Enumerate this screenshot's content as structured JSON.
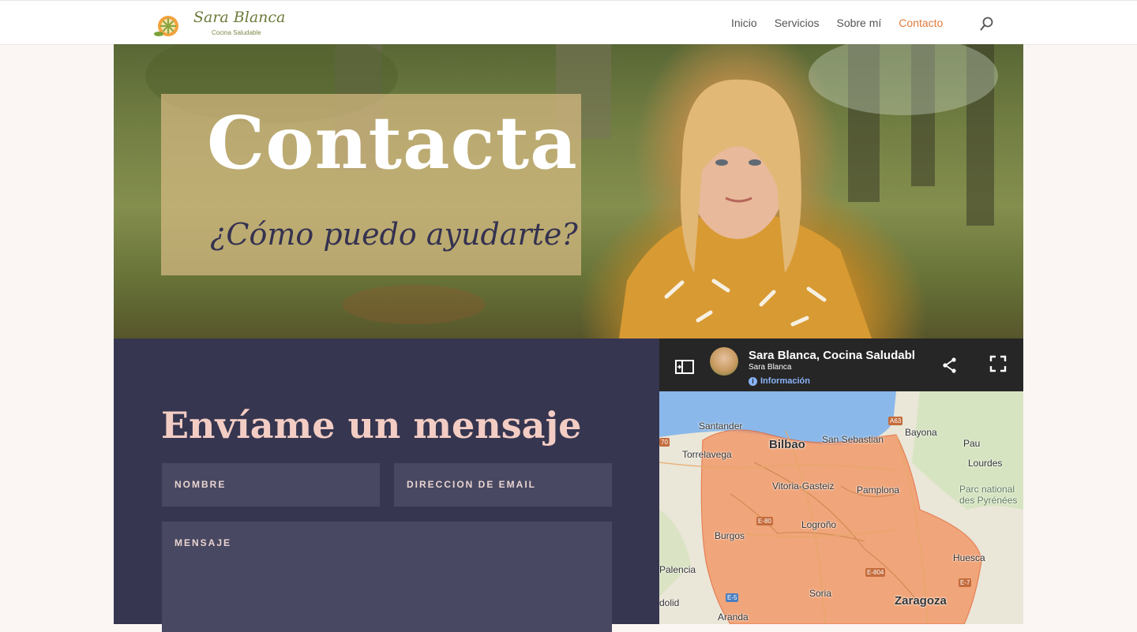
{
  "brand": {
    "name": "Sara Blanca",
    "tagline": "Cocina Saludable"
  },
  "nav": {
    "items": [
      "Inicio",
      "Servicios",
      "Sobre mí",
      "Contacto"
    ],
    "active": "Contacto"
  },
  "hero": {
    "title": "Contacta",
    "subtitle": "¿Cómo puedo ayudarte?"
  },
  "form": {
    "title": "Envíame un mensaje",
    "name_placeholder": "NOMBRE",
    "email_placeholder": "DIRECCION DE EMAIL",
    "message_placeholder": "MENSAJE"
  },
  "map": {
    "title": "Sara Blanca, Cocina Saludabl",
    "owner": "Sara Blanca",
    "info_label": "Información",
    "cities": [
      "Santander",
      "Bilbao",
      "San Sebastian",
      "Bayona",
      "Pau",
      "Lourdes",
      "Torrelavega",
      "Vitoria-Gasteiz",
      "Pamplona",
      "Parc national des Pyrénées",
      "Logroño",
      "Burgos",
      "Huesca",
      "Palencia",
      "Soria",
      "Zaragoza",
      "dolid",
      "Aranda"
    ],
    "roads": [
      "A63",
      "70",
      "E-80",
      "E-804",
      "E-7",
      "E-5"
    ],
    "colors": {
      "service_area": "#f39766",
      "water": "#8ab8ea",
      "land": "#eae6d8"
    }
  },
  "colors": {
    "accent": "#e07b3b",
    "form_bg": "#363650",
    "form_title": "#f3cdc4",
    "field_bg": "#484862"
  }
}
